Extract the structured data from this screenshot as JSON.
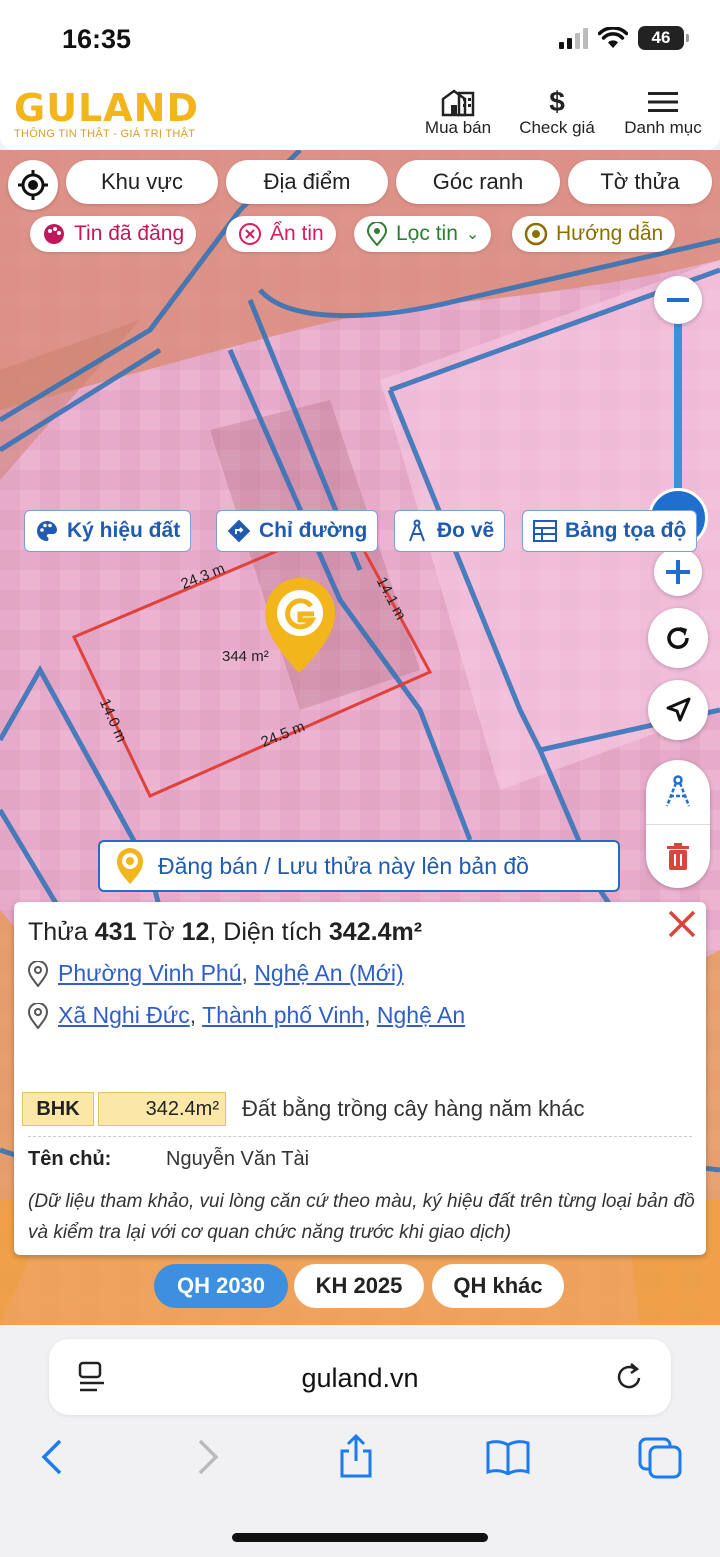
{
  "status": {
    "time": "16:35",
    "battery": "46"
  },
  "header": {
    "logo_word": "GULAND",
    "logo_tagline": "THÔNG TIN THẬT - GIÁ TRỊ THẬT",
    "buttons": [
      {
        "label": "Mua bán",
        "icon": "building-icon"
      },
      {
        "label": "Check giá",
        "icon": "dollar-icon"
      },
      {
        "label": "Danh mục",
        "icon": "menu-icon"
      }
    ]
  },
  "map": {
    "chips": [
      "Khu vực",
      "Địa điểm",
      "Góc ranh",
      "Tờ thửa"
    ],
    "pills": [
      {
        "label": "Tin đã đăng",
        "color": "#c2185b"
      },
      {
        "label": "Ẩn tin",
        "color": "#d81b60"
      },
      {
        "label": "Lọc tin",
        "color": "#2e7d32"
      },
      {
        "label": "Hướng dẫn",
        "color": "#8d6e00"
      }
    ],
    "zoom_level": "100",
    "parcel": {
      "area_label": "344 m²",
      "edges": [
        "24.3 m",
        "14.1 m",
        "24.5 m",
        "14.0 m"
      ]
    },
    "post_bar_text": "Đăng bán / Lưu thửa này lên bản đồ"
  },
  "card": {
    "title_prefix": "Thửa ",
    "parcel_no": "431",
    "sheet_label": " Tờ ",
    "sheet_no": "12",
    "area_label": ", Diện tích ",
    "area": "342.4m²",
    "address_new": {
      "ward": "Phường Vinh Phú",
      "province": "Nghệ An (Mới)"
    },
    "address_old": {
      "commune": "Xã Nghi Đức",
      "city": "Thành phố Vinh",
      "province": "Nghệ An"
    },
    "land_code": "BHK",
    "land_area": "342.4m²",
    "land_desc": "Đất bằng trồng cây hàng năm khác",
    "owner_key": "Tên chủ:",
    "owner_name": "Nguyễn Văn Tài",
    "note": "(Dữ liệu tham khảo, vui lòng căn cứ theo màu, ký hiệu đất trên từng loại bản đồ và kiểm tra lại với cơ quan chức năng trước khi giao dịch)",
    "actions": [
      "Ký hiệu đất",
      "Chỉ đường",
      "Đo vẽ",
      "Bảng tọa độ"
    ]
  },
  "plan_tabs": [
    {
      "label": "QH 2030",
      "active": true
    },
    {
      "label": "KH 2025",
      "active": false
    },
    {
      "label": "QH khác",
      "active": false
    }
  ],
  "browser": {
    "url": "guland.vn"
  }
}
